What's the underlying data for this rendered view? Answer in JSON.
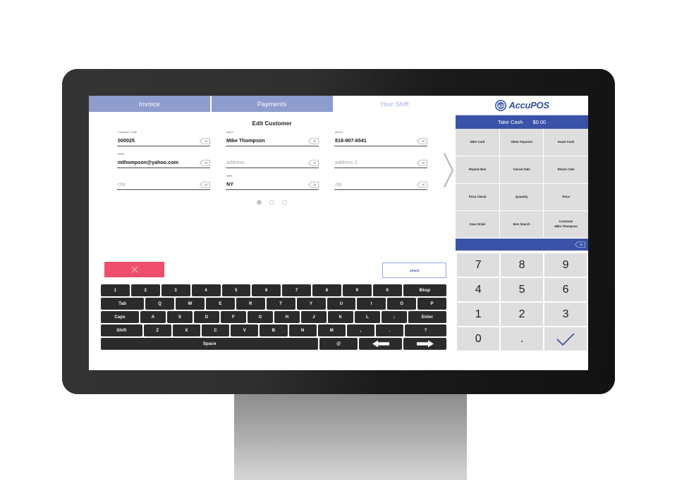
{
  "device": {
    "type": "desktop-monitor"
  },
  "pos_app": {
    "tabs": [
      {
        "label": "Invoice",
        "active": true
      },
      {
        "label": "Payments",
        "active": true
      },
      {
        "label": "Your Shift",
        "active": false
      }
    ],
    "form": {
      "title": "Edit Customer",
      "fields": [
        {
          "label": "Customer Code",
          "value": "000025",
          "is_placeholder": false,
          "clear_icon": "backspace-clear-icon"
        },
        {
          "label": "name",
          "value": "Mike Thompson",
          "is_placeholder": false,
          "clear_icon": "backspace-clear-icon"
        },
        {
          "label": "phone",
          "value": "818-907-6541",
          "is_placeholder": false,
          "clear_icon": "backspace-clear-icon"
        },
        {
          "label": "email",
          "value": "mthompson@yahoo.com",
          "is_placeholder": false,
          "clear_icon": "backspace-clear-icon"
        },
        {
          "label": "",
          "value": "address",
          "is_placeholder": true,
          "clear_icon": "backspace-clear-icon"
        },
        {
          "label": "",
          "value": "address 2",
          "is_placeholder": true,
          "clear_icon": "backspace-clear-icon"
        },
        {
          "label": "",
          "value": "city",
          "is_placeholder": true,
          "clear_icon": "backspace-clear-icon"
        },
        {
          "label": "state",
          "value": "NY",
          "is_placeholder": false,
          "clear_icon": "backspace-clear-icon"
        },
        {
          "label": "",
          "value": "zip",
          "is_placeholder": true,
          "clear_icon": "backspace-clear-icon"
        }
      ],
      "pagination": {
        "total": 3,
        "current": 1
      },
      "next_page_icon": "chevron-right-icon"
    },
    "actions": {
      "cancel_icon": "close-x-icon",
      "cancel_color": "#ef4e6d",
      "attach_label": "attach"
    },
    "keyboard": {
      "rows": [
        [
          "1",
          "2",
          "3",
          "4",
          "5",
          "6",
          "7",
          "8",
          "9",
          "0",
          "Bksp"
        ],
        [
          "Tab",
          "Q",
          "W",
          "E",
          "R",
          "T",
          "Y",
          "U",
          "I",
          "O",
          "P"
        ],
        [
          "Caps",
          "A",
          "S",
          "D",
          "F",
          "G",
          "H",
          "J",
          "K",
          "L",
          ";",
          "Enter"
        ],
        [
          "Shift",
          "Z",
          "X",
          "C",
          "V",
          "B",
          "N",
          "M",
          ",",
          ".",
          "?"
        ],
        [
          "Space",
          "@",
          "left-arrow-icon",
          "right-arrow-icon"
        ]
      ],
      "space_label": "Space",
      "at_label": "@"
    }
  },
  "accupos": {
    "brand": {
      "name": "AccuPOS",
      "mark": "accupos-logo-icon",
      "color": "#33519c"
    },
    "status_bar": {
      "label": "Take Cash",
      "amount": "$0.00",
      "color": "#3a52a8"
    },
    "function_buttons": [
      "EMV Card",
      "Other Payment",
      "Exact Cash",
      "Repeat Item",
      "Cancel Sale",
      "Return Sale",
      "Price Check",
      "Quantity",
      "Price",
      "Save Order",
      "Item Search",
      "Customer"
    ],
    "customer_button": {
      "line1": "Customer",
      "line2": "Mike Thompson"
    },
    "entry_display": {
      "value": "",
      "clear_icon": "backspace-clear-icon"
    },
    "numpad": {
      "keys": [
        "7",
        "8",
        "9",
        "4",
        "5",
        "6",
        "1",
        "2",
        "3",
        "0",
        "."
      ],
      "enter_icon": "checkmark-icon"
    }
  }
}
